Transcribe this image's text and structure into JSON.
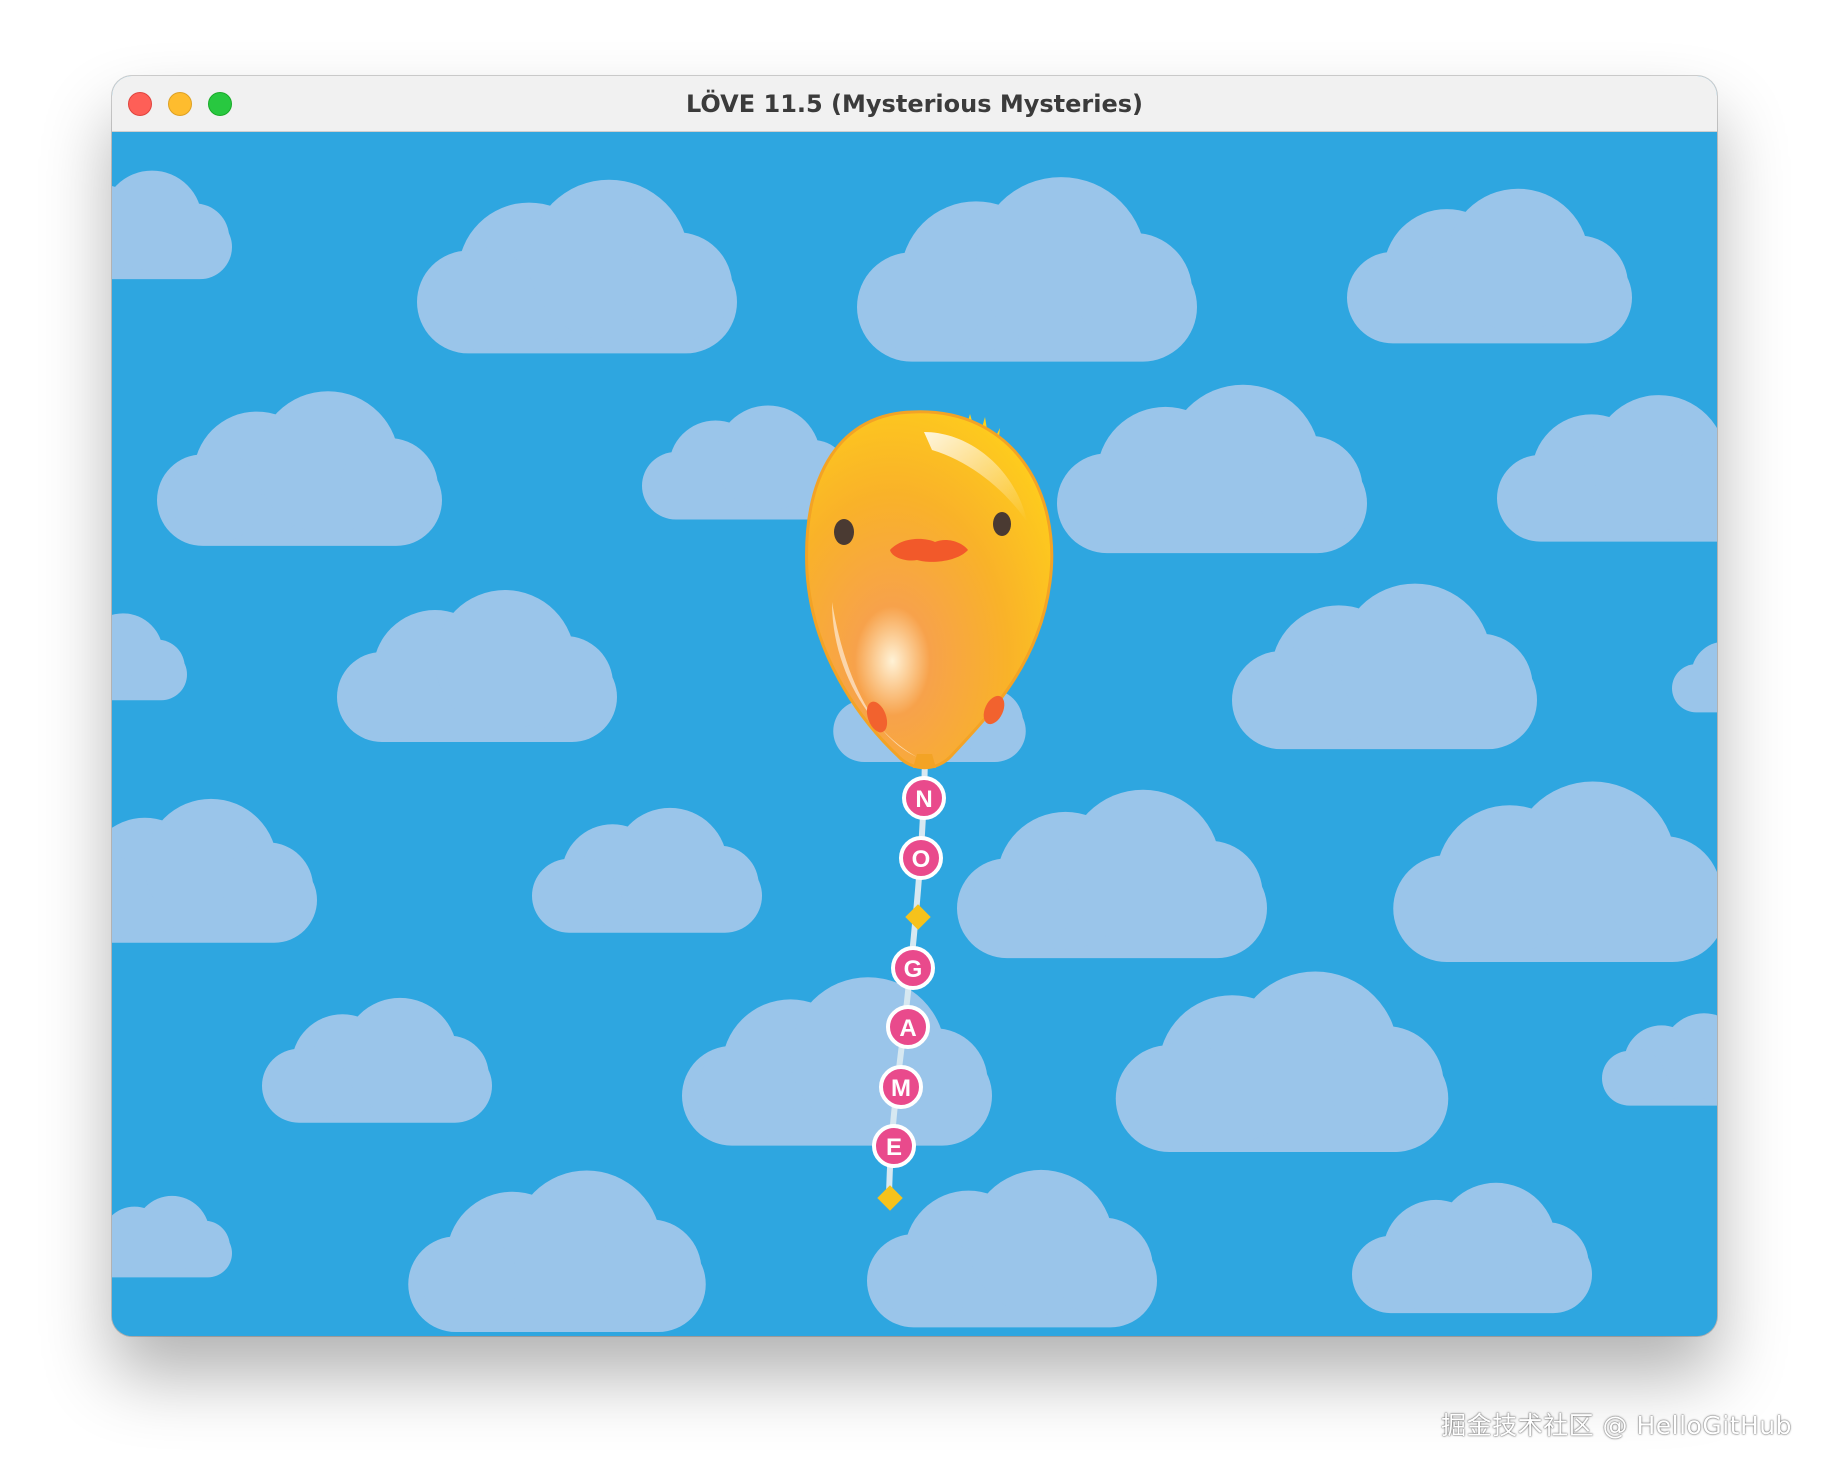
{
  "window": {
    "title": "LÖVE 11.5 (Mysterious Mysteries)",
    "controls": [
      "close-button",
      "minimize-button",
      "zoom-button"
    ]
  },
  "scene": {
    "background_color": "#2ea6e0",
    "cloud_color": "#9ac5ea",
    "balloon_color": "#f9b529",
    "bead_color": "#e94a8c",
    "diamond_color": "#f6c21b",
    "string_color": "#cfe3ee",
    "letters": [
      "N",
      "O",
      "G",
      "A",
      "M",
      "E"
    ]
  },
  "watermark": {
    "text": "掘金技术社区 @ HelloGitHub"
  }
}
